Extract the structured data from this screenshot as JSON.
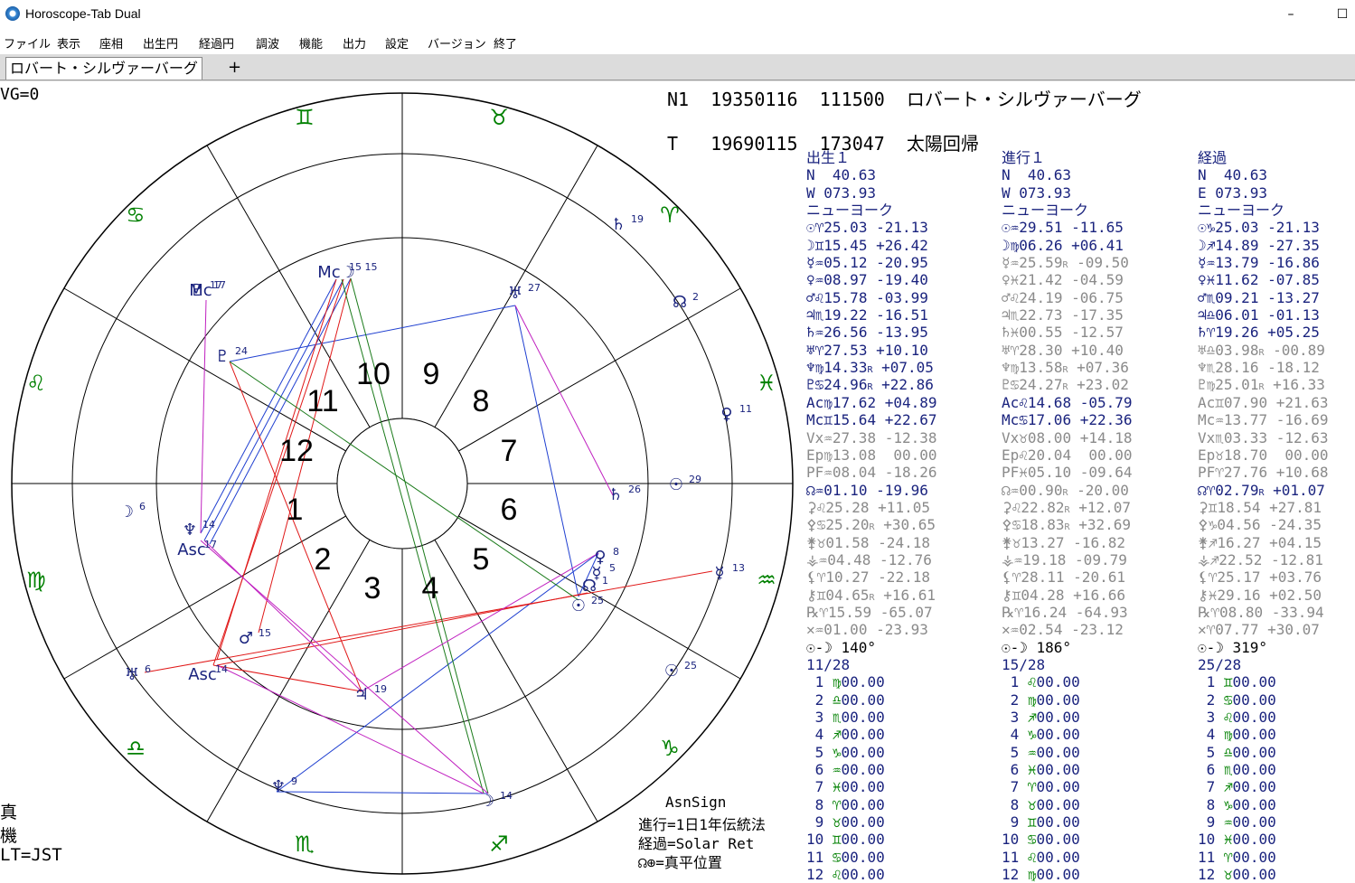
{
  "window": {
    "title": "Horoscope-Tab Dual",
    "minimize": "–",
    "maximize": "☐"
  },
  "menu": [
    "ファイル",
    "表示",
    "座相",
    "出生円",
    "経過円",
    "調波",
    "機能",
    "出力",
    "設定",
    "バージョン",
    "終了"
  ],
  "tabs": {
    "active": "ロバート・シルヴァーバーグ",
    "add": "+"
  },
  "chart_header": {
    "vg": "VG=0",
    "natal": "N1  19350116  111500  ロバート・シルヴァーバーグ",
    "transit": "T   19690115  173047  太陽回帰"
  },
  "wheel": {
    "house_numbers": [
      "1",
      "2",
      "3",
      "4",
      "5",
      "6",
      "7",
      "8",
      "9",
      "10",
      "11",
      "12"
    ],
    "sign_glyphs": [
      "♈",
      "♉",
      "♊",
      "♋",
      "♌",
      "♍",
      "♎",
      "♏",
      "♐",
      "♑",
      "♒",
      "♓"
    ],
    "planet_labels": [
      {
        "glyph": "☉",
        "deg": "29"
      },
      {
        "glyph": "☿",
        "deg": "13"
      },
      {
        "glyph": "♀",
        "deg": "11"
      },
      {
        "glyph": "♄",
        "deg": "19"
      },
      {
        "glyph": "☊",
        "deg": "2"
      },
      {
        "glyph": "♇",
        "deg": "17"
      },
      {
        "glyph": "☽",
        "deg": "6"
      },
      {
        "glyph": "♅",
        "deg": "6"
      },
      {
        "glyph": "♆",
        "deg": "9"
      },
      {
        "glyph": "☉",
        "deg": "25"
      },
      {
        "glyph": "Mc",
        "deg": "17"
      },
      {
        "glyph": "Mc☽",
        "deg": "15 15"
      },
      {
        "glyph": "♅",
        "deg": "27"
      },
      {
        "glyph": "♇",
        "deg": "24"
      },
      {
        "glyph": "♄",
        "deg": "26"
      },
      {
        "glyph": "♀",
        "deg": "8"
      },
      {
        "glyph": "☿",
        "deg": "5"
      },
      {
        "glyph": "☊",
        "deg": "1"
      },
      {
        "glyph": "☉",
        "deg": "25"
      },
      {
        "glyph": "♂",
        "deg": "15"
      },
      {
        "glyph": "Asc",
        "deg": "14"
      },
      {
        "glyph": "♃",
        "deg": "19"
      },
      {
        "glyph": "☽",
        "deg": "14"
      },
      {
        "glyph": "♆",
        "deg": "14"
      },
      {
        "glyph": "Asc",
        "deg": "17"
      }
    ]
  },
  "left_notes": [
    "真",
    "機",
    "LT=JST"
  ],
  "footer_notes": [
    "AsnSign",
    "進行=1日1年伝統法",
    "経過=Solar Ret",
    "☊⊕=真平位置"
  ],
  "columns": [
    {
      "title": "出生１",
      "lat": "N  40.63",
      "lon": "W 073.93",
      "place": "ニューヨーク",
      "bodies": [
        {
          "glyph": "☉",
          "sign": "♈",
          "value": "25.03",
          "r": "",
          "lat": "-21.13",
          "dim": false
        },
        {
          "glyph": "☽",
          "sign": "♊",
          "value": "15.45",
          "r": "",
          "lat": "+26.42",
          "dim": false
        },
        {
          "glyph": "☿",
          "sign": "♒",
          "value": "05.12",
          "r": "",
          "lat": "-20.95",
          "dim": false
        },
        {
          "glyph": "♀",
          "sign": "♒",
          "value": "08.97",
          "r": "",
          "lat": "-19.40",
          "dim": false
        },
        {
          "glyph": "♂",
          "sign": "♌",
          "value": "15.78",
          "r": "",
          "lat": "-03.99",
          "dim": false
        },
        {
          "glyph": "♃",
          "sign": "♏",
          "value": "19.22",
          "r": "",
          "lat": "-16.51",
          "dim": false
        },
        {
          "glyph": "♄",
          "sign": "♒",
          "value": "26.56",
          "r": "",
          "lat": "-13.95",
          "dim": false
        },
        {
          "glyph": "♅",
          "sign": "♈",
          "value": "27.53",
          "r": "",
          "lat": "+10.10",
          "dim": false
        },
        {
          "glyph": "♆",
          "sign": "♍",
          "value": "14.33",
          "r": "R",
          "lat": "+07.05",
          "dim": false
        },
        {
          "glyph": "♇",
          "sign": "♋",
          "value": "24.96",
          "r": "R",
          "lat": "+22.86",
          "dim": false
        },
        {
          "glyph": "Ac",
          "sign": "♍",
          "value": "17.62",
          "r": "",
          "lat": "+04.89",
          "dim": false
        },
        {
          "glyph": "Mc",
          "sign": "♊",
          "value": "15.64",
          "r": "",
          "lat": "+22.67",
          "dim": false
        },
        {
          "glyph": "Vx",
          "sign": "♒",
          "value": "27.38",
          "r": "",
          "lat": "-12.38",
          "dim": true
        },
        {
          "glyph": "Ep",
          "sign": "♍",
          "value": "13.08",
          "r": "",
          "lat": " 00.00",
          "dim": true
        },
        {
          "glyph": "PF",
          "sign": "♒",
          "value": "08.04",
          "r": "",
          "lat": "-18.26",
          "dim": true
        },
        {
          "glyph": "☊",
          "sign": "♒",
          "value": "01.10",
          "r": "",
          "lat": "-19.96",
          "dim": false
        },
        {
          "glyph": "⚳",
          "sign": "♌",
          "value": "25.28",
          "r": "",
          "lat": "+11.05",
          "dim": true
        },
        {
          "glyph": "⚴",
          "sign": "♋",
          "value": "25.20",
          "r": "R",
          "lat": "+30.65",
          "dim": true
        },
        {
          "glyph": "⚵",
          "sign": "♉",
          "value": "01.58",
          "r": "",
          "lat": "-24.18",
          "dim": true
        },
        {
          "glyph": "⚶",
          "sign": "♒",
          "value": "04.48",
          "r": "",
          "lat": "-12.76",
          "dim": true
        },
        {
          "glyph": "⚸",
          "sign": "♈",
          "value": "10.27",
          "r": "",
          "lat": "-22.18",
          "dim": true
        },
        {
          "glyph": "⚷",
          "sign": "♊",
          "value": "04.65",
          "r": "R",
          "lat": "+16.61",
          "dim": true
        },
        {
          "glyph": "℞",
          "sign": "♈",
          "value": "15.59",
          "r": "",
          "lat": "-65.07",
          "dim": true
        },
        {
          "glyph": "✕",
          "sign": "♒",
          "value": "01.00",
          "r": "",
          "lat": "-23.93",
          "dim": true
        }
      ],
      "phase": "☉-☽ 140°",
      "phase_ratio": "11/28",
      "cusps": [
        {
          "n": " 1",
          "sign": "♍",
          "value": "00.00"
        },
        {
          "n": " 2",
          "sign": "♎",
          "value": "00.00"
        },
        {
          "n": " 3",
          "sign": "♏",
          "value": "00.00"
        },
        {
          "n": " 4",
          "sign": "♐",
          "value": "00.00"
        },
        {
          "n": " 5",
          "sign": "♑",
          "value": "00.00"
        },
        {
          "n": " 6",
          "sign": "♒",
          "value": "00.00"
        },
        {
          "n": " 7",
          "sign": "♓",
          "value": "00.00"
        },
        {
          "n": " 8",
          "sign": "♈",
          "value": "00.00"
        },
        {
          "n": " 9",
          "sign": "♉",
          "value": "00.00"
        },
        {
          "n": "10",
          "sign": "♊",
          "value": "00.00"
        },
        {
          "n": "11",
          "sign": "♋",
          "value": "00.00"
        },
        {
          "n": "12",
          "sign": "♌",
          "value": "00.00"
        }
      ]
    },
    {
      "title": "進行１",
      "lat": "N  40.63",
      "lon": "W 073.93",
      "place": "ニューヨーク",
      "bodies": [
        {
          "glyph": "☉",
          "sign": "♒",
          "value": "29.51",
          "r": "",
          "lat": "-11.65",
          "dim": false
        },
        {
          "glyph": "☽",
          "sign": "♍",
          "value": "06.26",
          "r": "",
          "lat": "+06.41",
          "dim": false
        },
        {
          "glyph": "☿",
          "sign": "♒",
          "value": "25.59",
          "r": "R",
          "lat": "-09.50",
          "dim": true
        },
        {
          "glyph": "♀",
          "sign": "♓",
          "value": "21.42",
          "r": "",
          "lat": "-04.59",
          "dim": true
        },
        {
          "glyph": "♂",
          "sign": "♌",
          "value": "24.19",
          "r": "",
          "lat": "-06.75",
          "dim": true
        },
        {
          "glyph": "♃",
          "sign": "♏",
          "value": "22.73",
          "r": "",
          "lat": "-17.35",
          "dim": true
        },
        {
          "glyph": "♄",
          "sign": "♓",
          "value": "00.55",
          "r": "",
          "lat": "-12.57",
          "dim": true
        },
        {
          "glyph": "♅",
          "sign": "♈",
          "value": "28.30",
          "r": "",
          "lat": "+10.40",
          "dim": true
        },
        {
          "glyph": "♆",
          "sign": "♍",
          "value": "13.58",
          "r": "R",
          "lat": "+07.36",
          "dim": true
        },
        {
          "glyph": "♇",
          "sign": "♋",
          "value": "24.27",
          "r": "R",
          "lat": "+23.02",
          "dim": true
        },
        {
          "glyph": "Ac",
          "sign": "♌",
          "value": "14.68",
          "r": "",
          "lat": "-05.79",
          "dim": false
        },
        {
          "glyph": "Mc",
          "sign": "♋",
          "value": "17.06",
          "r": "",
          "lat": "+22.36",
          "dim": false
        },
        {
          "glyph": "Vx",
          "sign": "♉",
          "value": "08.00",
          "r": "",
          "lat": "+14.18",
          "dim": true
        },
        {
          "glyph": "Ep",
          "sign": "♌",
          "value": "20.04",
          "r": "",
          "lat": " 00.00",
          "dim": true
        },
        {
          "glyph": "PF",
          "sign": "♓",
          "value": "05.10",
          "r": "",
          "lat": "-09.64",
          "dim": true
        },
        {
          "glyph": "☊",
          "sign": "♒",
          "value": "00.90",
          "r": "R",
          "lat": "-20.00",
          "dim": true
        },
        {
          "glyph": "⚳",
          "sign": "♌",
          "value": "22.82",
          "r": "R",
          "lat": "+12.07",
          "dim": true
        },
        {
          "glyph": "⚴",
          "sign": "♋",
          "value": "18.83",
          "r": "R",
          "lat": "+32.69",
          "dim": true
        },
        {
          "glyph": "⚵",
          "sign": "♉",
          "value": "13.27",
          "r": "",
          "lat": "-16.82",
          "dim": true
        },
        {
          "glyph": "⚶",
          "sign": "♒",
          "value": "19.18",
          "r": "",
          "lat": "-09.79",
          "dim": true
        },
        {
          "glyph": "⚸",
          "sign": "♈",
          "value": "28.11",
          "r": "",
          "lat": "-20.61",
          "dim": true
        },
        {
          "glyph": "⚷",
          "sign": "♊",
          "value": "04.28",
          "r": "",
          "lat": "+16.66",
          "dim": true
        },
        {
          "glyph": "℞",
          "sign": "♈",
          "value": "16.24",
          "r": "",
          "lat": "-64.93",
          "dim": true
        },
        {
          "glyph": "✕",
          "sign": "♒",
          "value": "02.54",
          "r": "",
          "lat": "-23.12",
          "dim": true
        }
      ],
      "phase": "☉-☽ 186°",
      "phase_ratio": "15/28",
      "cusps": [
        {
          "n": " 1",
          "sign": "♌",
          "value": "00.00"
        },
        {
          "n": " 2",
          "sign": "♍",
          "value": "00.00"
        },
        {
          "n": " 3",
          "sign": "♐",
          "value": "00.00"
        },
        {
          "n": " 4",
          "sign": "♑",
          "value": "00.00"
        },
        {
          "n": " 5",
          "sign": "♒",
          "value": "00.00"
        },
        {
          "n": " 6",
          "sign": "♓",
          "value": "00.00"
        },
        {
          "n": " 7",
          "sign": "♈",
          "value": "00.00"
        },
        {
          "n": " 8",
          "sign": "♉",
          "value": "00.00"
        },
        {
          "n": " 9",
          "sign": "♊",
          "value": "00.00"
        },
        {
          "n": "10",
          "sign": "♋",
          "value": "00.00"
        },
        {
          "n": "11",
          "sign": "♌",
          "value": "00.00"
        },
        {
          "n": "12",
          "sign": "♍",
          "value": "00.00"
        }
      ]
    },
    {
      "title": "経過",
      "lat": "N  40.63",
      "lon": "E 073.93",
      "place": "ニューヨーク",
      "bodies": [
        {
          "glyph": "☉",
          "sign": "♑",
          "value": "25.03",
          "r": "",
          "lat": "-21.13",
          "dim": false
        },
        {
          "glyph": "☽",
          "sign": "♐",
          "value": "14.89",
          "r": "",
          "lat": "-27.35",
          "dim": false
        },
        {
          "glyph": "☿",
          "sign": "♒",
          "value": "13.79",
          "r": "",
          "lat": "-16.86",
          "dim": false
        },
        {
          "glyph": "♀",
          "sign": "♓",
          "value": "11.62",
          "r": "",
          "lat": "-07.85",
          "dim": false
        },
        {
          "glyph": "♂",
          "sign": "♏",
          "value": "09.21",
          "r": "",
          "lat": "-13.27",
          "dim": false
        },
        {
          "glyph": "♃",
          "sign": "♎",
          "value": "06.01",
          "r": "",
          "lat": "-01.13",
          "dim": false
        },
        {
          "glyph": "♄",
          "sign": "♈",
          "value": "19.26",
          "r": "",
          "lat": "+05.25",
          "dim": false
        },
        {
          "glyph": "♅",
          "sign": "♎",
          "value": "03.98",
          "r": "R",
          "lat": "-00.89",
          "dim": true
        },
        {
          "glyph": "♆",
          "sign": "♏",
          "value": "28.16",
          "r": "",
          "lat": "-18.12",
          "dim": true
        },
        {
          "glyph": "♇",
          "sign": "♍",
          "value": "25.01",
          "r": "R",
          "lat": "+16.33",
          "dim": true
        },
        {
          "glyph": "Ac",
          "sign": "♊",
          "value": "07.90",
          "r": "",
          "lat": "+21.63",
          "dim": true
        },
        {
          "glyph": "Mc",
          "sign": "♒",
          "value": "13.77",
          "r": "",
          "lat": "-16.69",
          "dim": true
        },
        {
          "glyph": "Vx",
          "sign": "♏",
          "value": "03.33",
          "r": "",
          "lat": "-12.63",
          "dim": true
        },
        {
          "glyph": "Ep",
          "sign": "♉",
          "value": "18.70",
          "r": "",
          "lat": " 00.00",
          "dim": true
        },
        {
          "glyph": "PF",
          "sign": "♈",
          "value": "27.76",
          "r": "",
          "lat": "+10.68",
          "dim": true
        },
        {
          "glyph": "☊",
          "sign": "♈",
          "value": "02.79",
          "r": "R",
          "lat": "+01.07",
          "dim": false
        },
        {
          "glyph": "⚳",
          "sign": "♊",
          "value": "18.54",
          "r": "",
          "lat": "+27.81",
          "dim": true
        },
        {
          "glyph": "⚴",
          "sign": "♑",
          "value": "04.56",
          "r": "",
          "lat": "-24.35",
          "dim": true
        },
        {
          "glyph": "⚵",
          "sign": "♐",
          "value": "16.27",
          "r": "",
          "lat": "+04.15",
          "dim": true
        },
        {
          "glyph": "⚶",
          "sign": "♐",
          "value": "22.52",
          "r": "",
          "lat": "-12.81",
          "dim": true
        },
        {
          "glyph": "⚸",
          "sign": "♈",
          "value": "25.17",
          "r": "",
          "lat": "+03.76",
          "dim": true
        },
        {
          "glyph": "⚷",
          "sign": "♓",
          "value": "29.16",
          "r": "",
          "lat": "+02.50",
          "dim": true
        },
        {
          "glyph": "℞",
          "sign": "♈",
          "value": "08.80",
          "r": "",
          "lat": "-33.94",
          "dim": true
        },
        {
          "glyph": "✕",
          "sign": "♈",
          "value": "07.77",
          "r": "",
          "lat": "+30.07",
          "dim": true
        }
      ],
      "phase": "☉-☽ 319°",
      "phase_ratio": "25/28",
      "cusps": [
        {
          "n": " 1",
          "sign": "♊",
          "value": "00.00"
        },
        {
          "n": " 2",
          "sign": "♋",
          "value": "00.00"
        },
        {
          "n": " 3",
          "sign": "♌",
          "value": "00.00"
        },
        {
          "n": " 4",
          "sign": "♍",
          "value": "00.00"
        },
        {
          "n": " 5",
          "sign": "♎",
          "value": "00.00"
        },
        {
          "n": " 6",
          "sign": "♏",
          "value": "00.00"
        },
        {
          "n": " 7",
          "sign": "♐",
          "value": "00.00"
        },
        {
          "n": " 8",
          "sign": "♑",
          "value": "00.00"
        },
        {
          "n": " 9",
          "sign": "♒",
          "value": "00.00"
        },
        {
          "n": "10",
          "sign": "♓",
          "value": "00.00"
        },
        {
          "n": "11",
          "sign": "♈",
          "value": "00.00"
        },
        {
          "n": "12",
          "sign": "♉",
          "value": "00.00"
        }
      ]
    }
  ]
}
